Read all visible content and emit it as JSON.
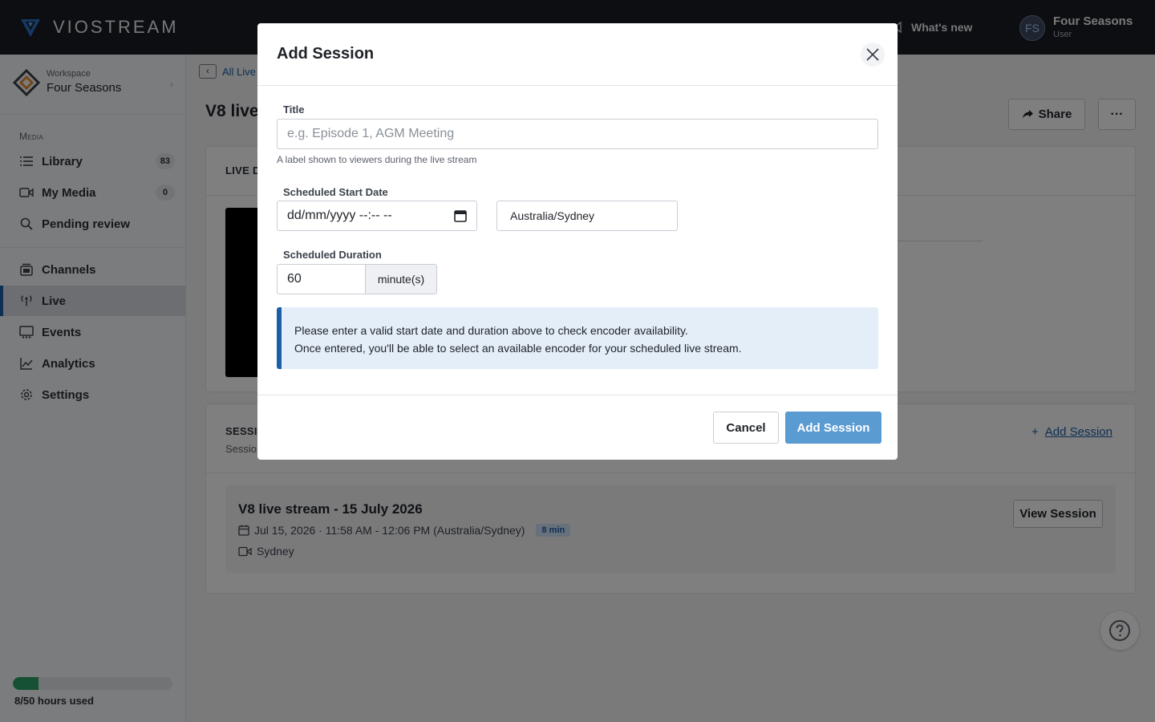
{
  "topbar": {
    "brand": "VIOSTREAM",
    "whats_new": "What's new",
    "user_initials": "FS",
    "user_name": "Four Seasons",
    "user_role": "User"
  },
  "sidebar": {
    "workspace_label": "Workspace",
    "workspace_name": "Four Seasons",
    "media_section": "Media",
    "items": [
      {
        "label": "Library",
        "count": "83",
        "icon": "list-icon"
      },
      {
        "label": "My Media",
        "count": "0",
        "icon": "video-icon"
      },
      {
        "label": "Pending review",
        "icon": "review-search-icon"
      },
      {
        "label": "Channels",
        "icon": "channels-icon"
      },
      {
        "label": "Live",
        "icon": "broadcast-icon",
        "active": true
      },
      {
        "label": "Events",
        "icon": "events-icon"
      },
      {
        "label": "Analytics",
        "icon": "analytics-icon"
      },
      {
        "label": "Settings",
        "icon": "gear-icon"
      }
    ],
    "usage_fraction": 0.16,
    "usage_text": "8/50 hours used"
  },
  "main": {
    "breadcrumb": "All Live",
    "page_title": "V8 live",
    "share_label": "Share",
    "more_label": "···",
    "live_header": "LIVE D",
    "sessions_header": "SESSI",
    "sessions_sub": "Sessio",
    "add_session_link": "Add Session",
    "session": {
      "title": "V8 live stream - 15 July 2026",
      "datetime": "Jul 15, 2026 · 11:58 AM - 12:06 PM (Australia/Sydney)",
      "duration_badge": "8 min",
      "location": "Sydney",
      "view_label": "View Session"
    }
  },
  "modal": {
    "title": "Add Session",
    "title_label": "Title",
    "title_placeholder": "e.g. Episode 1, AGM Meeting",
    "title_help": "A label shown to viewers during the live stream",
    "start_label": "Scheduled Start Date",
    "start_placeholder": "dd/mm/yyyy --:-- --",
    "timezone": "Australia/Sydney",
    "duration_label": "Scheduled Duration",
    "duration_value": "60",
    "duration_unit": "minute(s)",
    "info_line1": "Please enter a valid start date and duration above to check encoder availability.",
    "info_line2": "Once entered, you'll be able to select an available encoder for your scheduled live stream.",
    "cancel_label": "Cancel",
    "submit_label": "Add Session"
  },
  "colors": {
    "accent": "#1b5fa8",
    "primary_button": "#5a9bd2",
    "usage_fill": "#2fa36b"
  }
}
